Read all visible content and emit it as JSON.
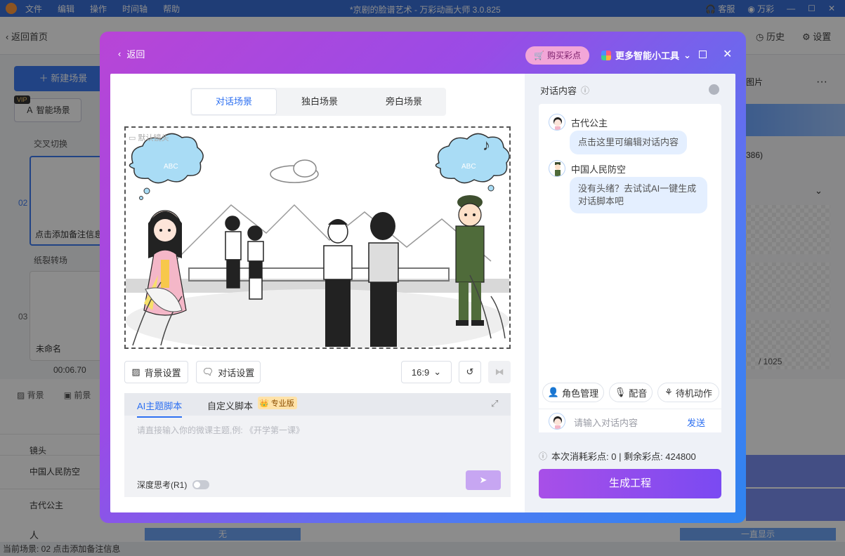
{
  "app": {
    "menu": [
      "文件",
      "编辑",
      "操作",
      "时间轴",
      "帮助"
    ],
    "title": "*京剧的脸谱艺术 - 万彩动画大师 3.0.825",
    "service": "客服",
    "user": "万彩",
    "back_home": "返回首页",
    "history": "历史",
    "settings": "设置",
    "new_scene": "新建场景",
    "smart_scene": "智能场景",
    "vip": "VIP",
    "transition1": "交叉切换",
    "transition2": "纸裂转场",
    "scene02_num": "02",
    "scene02_label": "点击添加备注信息",
    "scene03_num": "03",
    "scene03_label": "未命名",
    "duration": "00:06.70",
    "right_tab": "图片",
    "right_count": "386)",
    "right_page": "/ 1025",
    "bottom_tabs": [
      "背景",
      "前景"
    ],
    "tracks": [
      "镜头",
      "中国人民防空",
      "古代公主",
      "人"
    ],
    "timeline_none": "无",
    "timeline_show": "一直显示",
    "status": "当前场景: 02   点击添加备注信息"
  },
  "modal": {
    "back": "返回",
    "buy": "购买彩点",
    "tools": "更多智能小工具",
    "scene_tabs": [
      "对话场景",
      "独白场景",
      "旁白场景"
    ],
    "active_tab": 0,
    "stage": {
      "camera_label": "默认镜头",
      "bubble_text": "ABC"
    },
    "buttons": {
      "bg_settings": "背景设置",
      "dialog_settings": "对话设置",
      "ratio": "16:9"
    },
    "script": {
      "tab_ai": "AI主题脚本",
      "tab_custom": "自定义脚本",
      "pro_badge": "专业版",
      "placeholder": "请直接输入你的微课主题,例: 《开学第一课》",
      "deep_thinking": "深度思考(R1)"
    },
    "dialog": {
      "header": "对话内容",
      "messages": [
        {
          "speaker": "古代公主",
          "text": "点击这里可编辑对话内容"
        },
        {
          "speaker": "中国人民防空",
          "text": "没有头绪？去试试AI一键生成对话脚本吧"
        }
      ],
      "actions": [
        "角色管理",
        "配音",
        "待机动作"
      ],
      "input_placeholder": "请输入对话内容",
      "send": "发送"
    },
    "cost": "本次消耗彩点: 0 | 剩余彩点: 424800",
    "generate": "生成工程"
  }
}
